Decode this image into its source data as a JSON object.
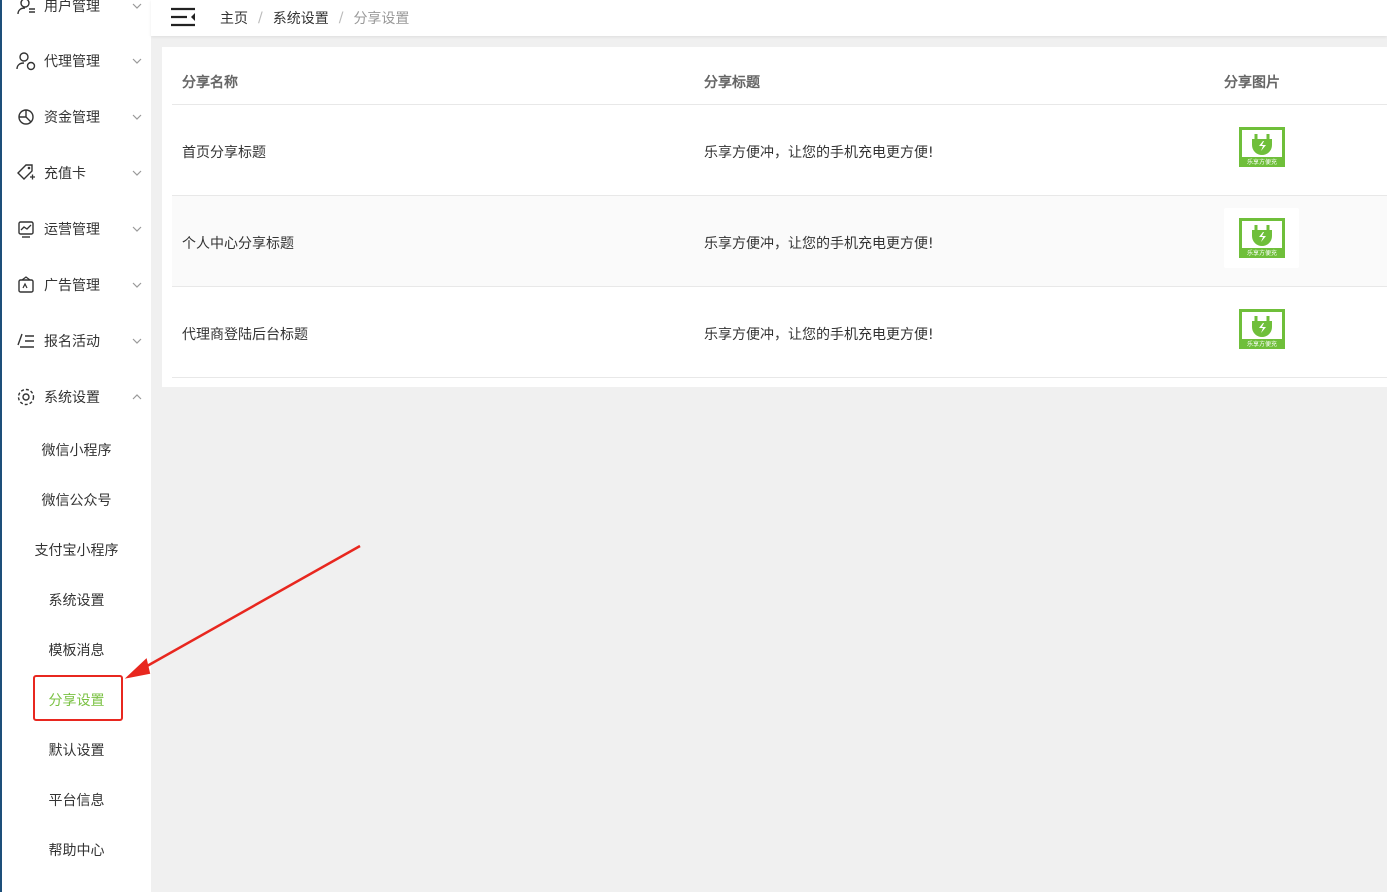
{
  "sidebar": {
    "menu": [
      {
        "label": "用户管理",
        "icon": "user-icon",
        "expanded": false
      },
      {
        "label": "代理管理",
        "icon": "agent-icon",
        "expanded": false
      },
      {
        "label": "资金管理",
        "icon": "pie-chart-icon",
        "expanded": false
      },
      {
        "label": "充值卡",
        "icon": "tag-icon",
        "expanded": false
      },
      {
        "label": "运营管理",
        "icon": "trend-icon",
        "expanded": false
      },
      {
        "label": "广告管理",
        "icon": "ad-icon",
        "expanded": false
      },
      {
        "label": "报名活动",
        "icon": "list-edit-icon",
        "expanded": false
      },
      {
        "label": "系统设置",
        "icon": "gear-icon",
        "expanded": true
      }
    ],
    "submenu": [
      {
        "label": "微信小程序"
      },
      {
        "label": "微信公众号"
      },
      {
        "label": "支付宝小程序"
      },
      {
        "label": "系统设置"
      },
      {
        "label": "模板消息"
      },
      {
        "label": "分享设置",
        "active": true
      },
      {
        "label": "默认设置"
      },
      {
        "label": "平台信息"
      },
      {
        "label": "帮助中心"
      }
    ]
  },
  "header": {
    "breadcrumb": [
      "主页",
      "系统设置",
      "分享设置"
    ],
    "separator": "/"
  },
  "table": {
    "columns": [
      "分享名称",
      "分享标题",
      "分享图片"
    ],
    "rows": [
      {
        "name": "首页分享标题",
        "title": "乐享方便冲，让您的手机充电更方便!",
        "image_text": "乐享方便充"
      },
      {
        "name": "个人中心分享标题",
        "title": "乐享方便冲，让您的手机充电更方便!",
        "image_text": "乐享方便充"
      },
      {
        "name": "代理商登陆后台标题",
        "title": "乐享方便冲，让您的手机充电更方便!",
        "image_text": "乐享方便充"
      }
    ]
  },
  "colors": {
    "accent_green": "#7ac143",
    "annotation_red": "#e8271f",
    "sidebar_border": "#1d4f7a"
  }
}
